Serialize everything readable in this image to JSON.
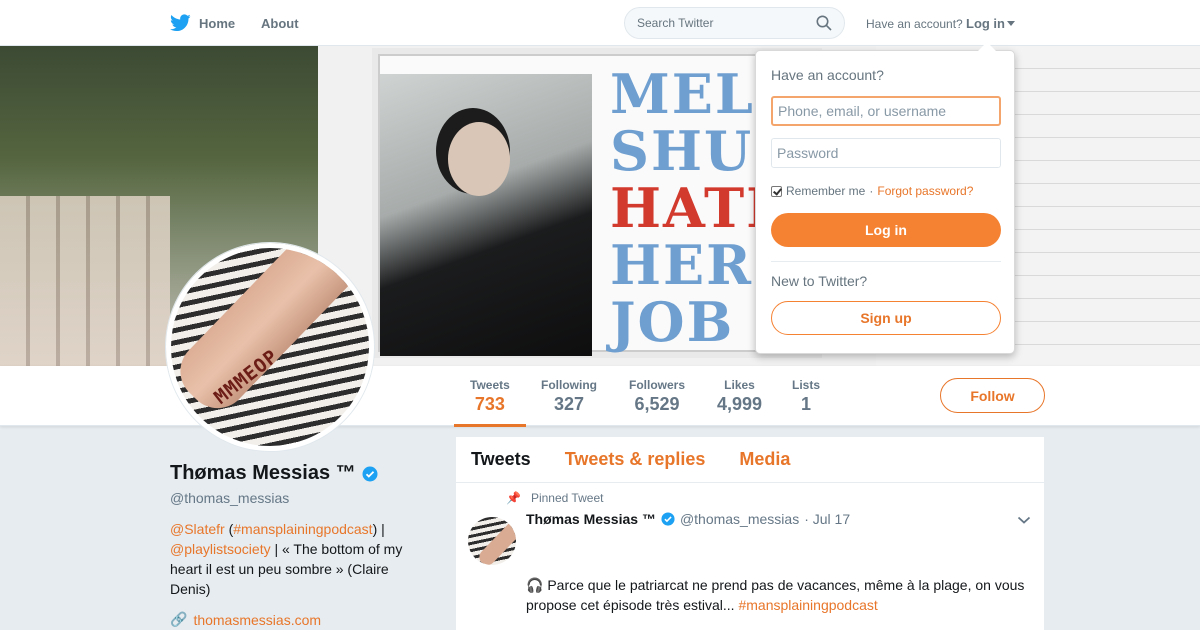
{
  "nav": {
    "home_label": "Home",
    "about_label": "About",
    "search_placeholder": "Search Twitter",
    "have_account": "Have an account?",
    "login_label": "Log in"
  },
  "profile": {
    "name": "Thømas Messias ™",
    "handle": "@thomas_messias",
    "bio": {
      "slatefr": "@Slatefr",
      "paren_open": " (",
      "hashtag": "#mansplainingpodcast",
      "paren_close": ") |",
      "playlist": "@playlistsociety",
      "rest": " | « The bottom of my heart il est un peu sombre » (Claire Denis)"
    },
    "website": "thomasmessias.com",
    "header_text": [
      "MELL",
      "SHUM",
      "HATE",
      "HER",
      "JOB"
    ]
  },
  "stats": [
    {
      "label": "Tweets",
      "value": "733"
    },
    {
      "label": "Following",
      "value": "327"
    },
    {
      "label": "Followers",
      "value": "6,529"
    },
    {
      "label": "Likes",
      "value": "4,999"
    },
    {
      "label": "Lists",
      "value": "1"
    }
  ],
  "follow_label": "Follow",
  "timeline": {
    "tabs": [
      "Tweets",
      "Tweets & replies",
      "Media"
    ],
    "tweet": {
      "pinned_label": "Pinned Tweet",
      "name": "Thømas Messias ™",
      "handle": "@thomas_messias",
      "date": "· Jul 17",
      "text_emoji": "🎧",
      "text": " Parce que le patriarcat ne prend pas de vacances, même à la plage, on vous propose cet épisode très estival... ",
      "hashtag": "#mansplainingpodcast"
    }
  },
  "dropdown": {
    "title": "Have an account?",
    "username_placeholder": "Phone, email, or username",
    "password_placeholder": "Password",
    "remember_label": "Remember me",
    "separator": "·",
    "forgot_label": "Forgot password?",
    "login_button": "Log in",
    "new_label": "New to Twitter?",
    "signup_button": "Sign up"
  },
  "colors": {
    "accent": "#e8762a",
    "twitter_blue": "#1da1f2"
  }
}
